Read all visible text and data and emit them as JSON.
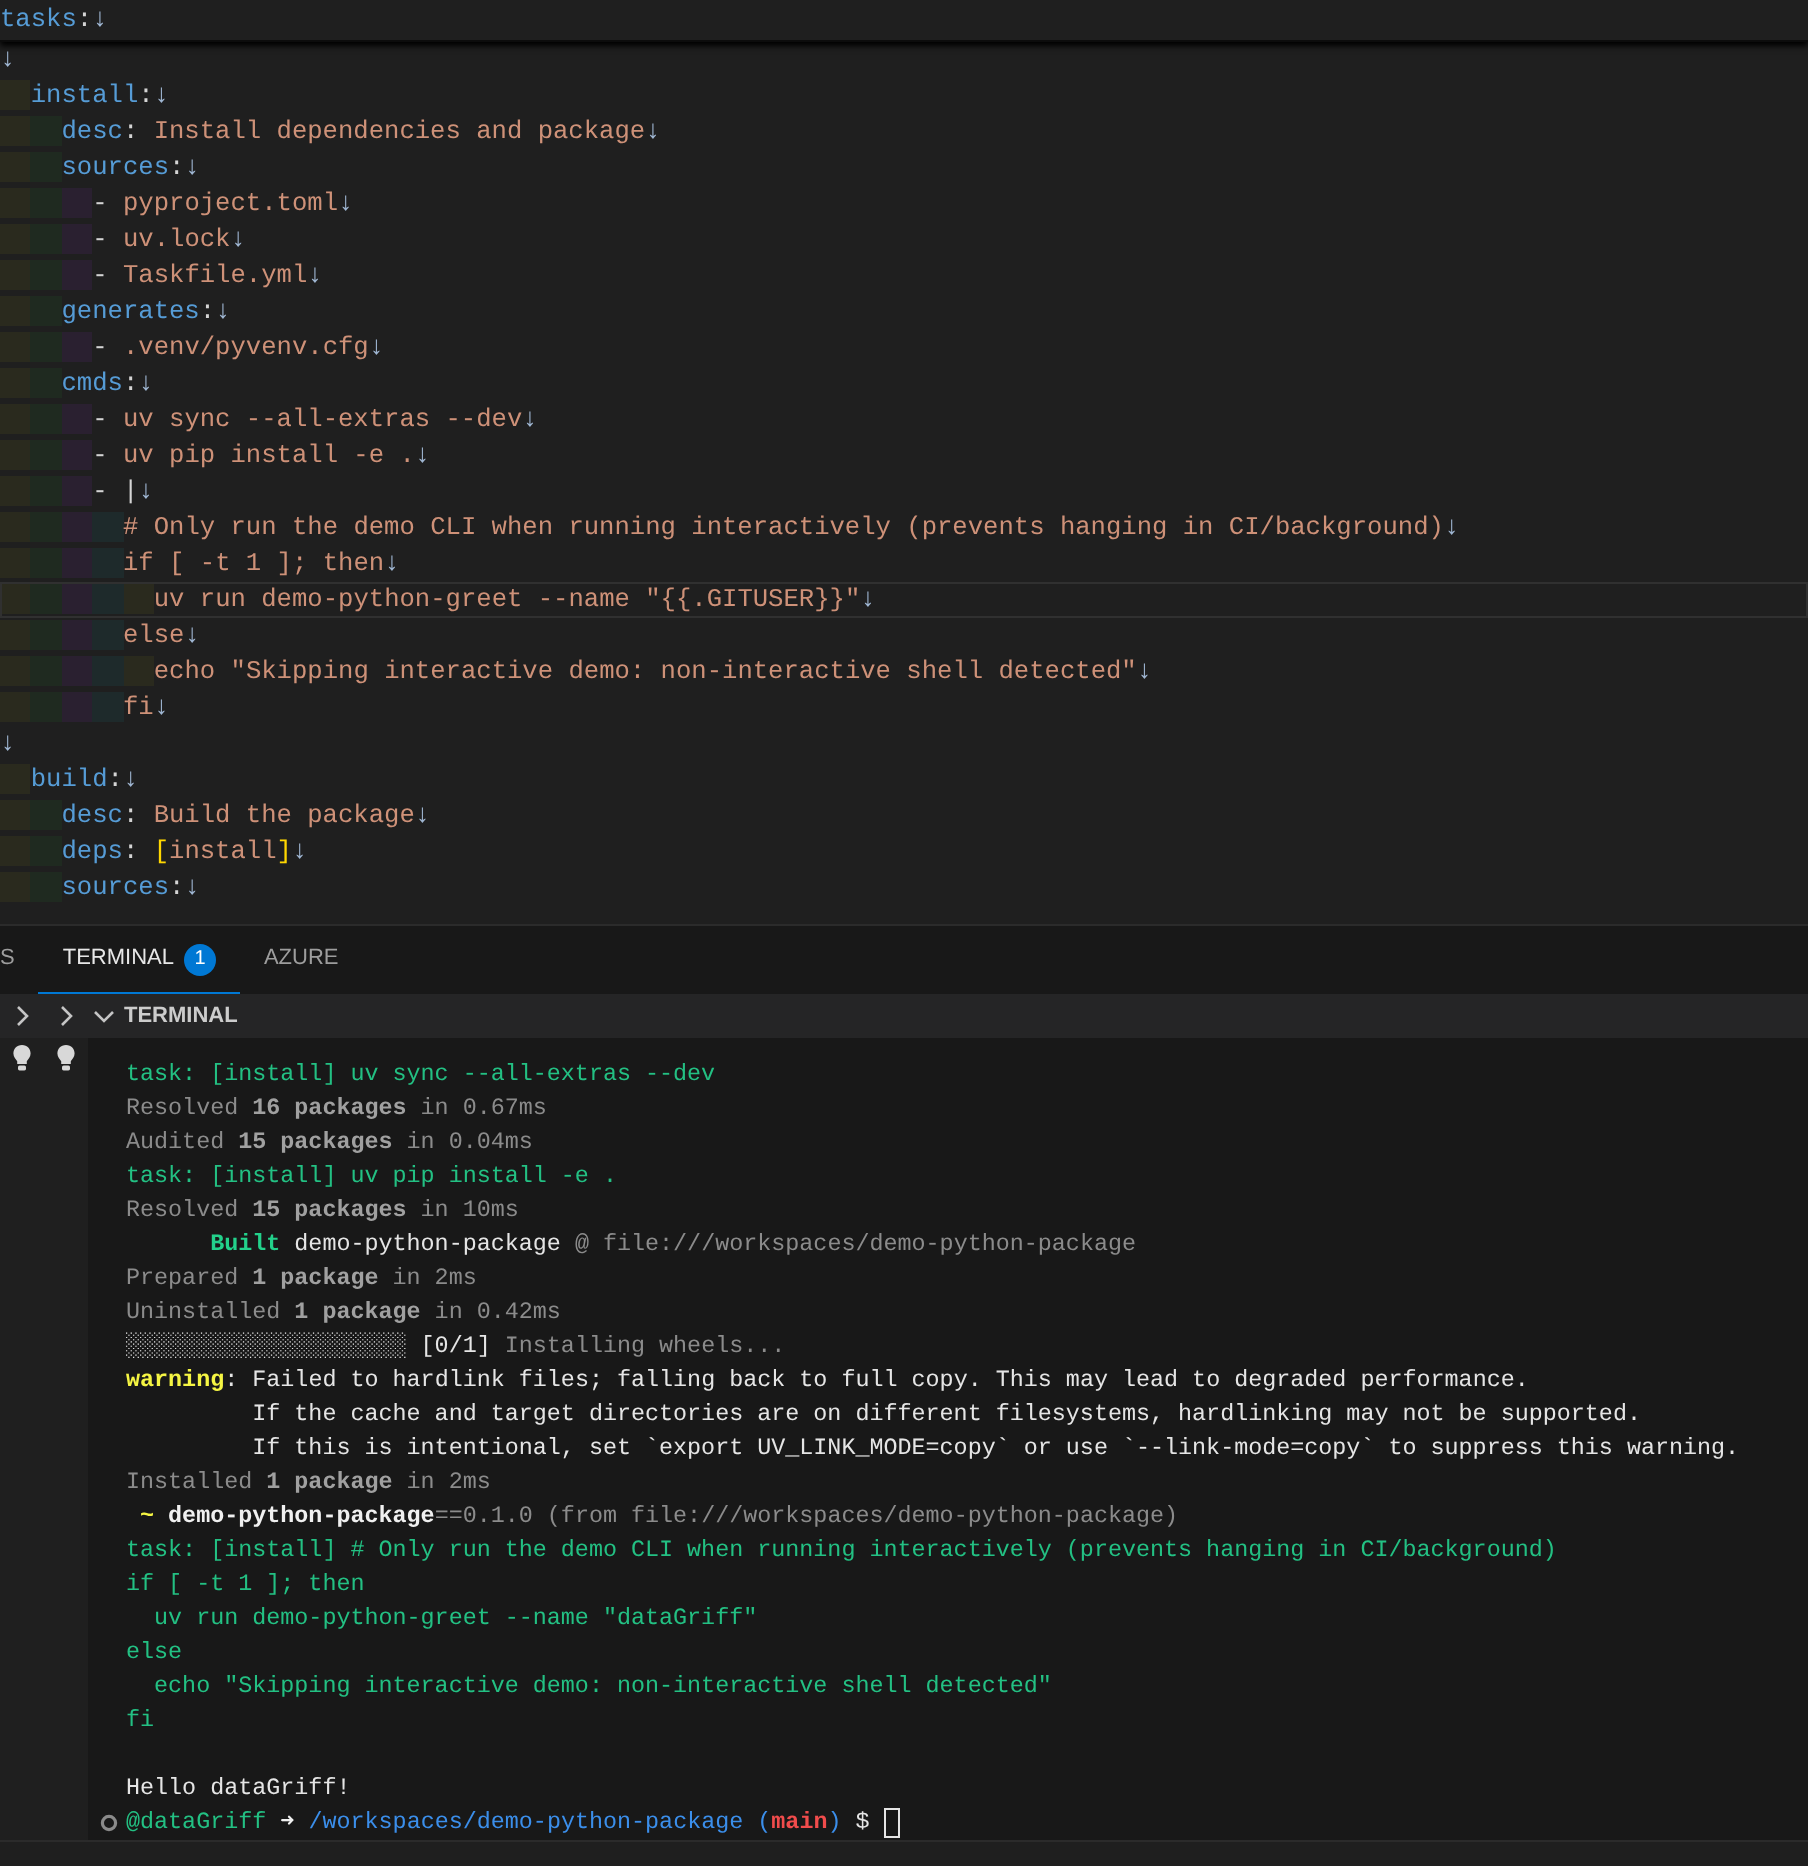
{
  "editor": {
    "sticky_line": [
      {
        "kind": "key",
        "text": "tasks"
      },
      {
        "kind": "punct",
        "text": ":"
      },
      {
        "kind": "eol",
        "text": "↓"
      }
    ],
    "lines": [
      {
        "current": false,
        "tokens": [
          {
            "kind": "eol",
            "text": "↓"
          }
        ]
      },
      {
        "current": false,
        "tokens": [
          {
            "kind": "key",
            "text": "  install"
          },
          {
            "kind": "punct",
            "text": ":"
          },
          {
            "kind": "eol",
            "text": "↓"
          }
        ]
      },
      {
        "current": false,
        "tokens": [
          {
            "kind": "key",
            "text": "    desc"
          },
          {
            "kind": "punct",
            "text": ": "
          },
          {
            "kind": "string",
            "text": "Install dependencies and package"
          },
          {
            "kind": "eol",
            "text": "↓"
          }
        ]
      },
      {
        "current": false,
        "tokens": [
          {
            "kind": "key",
            "text": "    sources"
          },
          {
            "kind": "punct",
            "text": ":"
          },
          {
            "kind": "eol",
            "text": "↓"
          }
        ]
      },
      {
        "current": false,
        "tokens": [
          {
            "kind": "punct",
            "text": "      - "
          },
          {
            "kind": "string",
            "text": "pyproject.toml"
          },
          {
            "kind": "eol",
            "text": "↓"
          }
        ]
      },
      {
        "current": false,
        "tokens": [
          {
            "kind": "punct",
            "text": "      - "
          },
          {
            "kind": "string",
            "text": "uv.lock"
          },
          {
            "kind": "eol",
            "text": "↓"
          }
        ]
      },
      {
        "current": false,
        "tokens": [
          {
            "kind": "punct",
            "text": "      - "
          },
          {
            "kind": "string",
            "text": "Taskfile.yml"
          },
          {
            "kind": "eol",
            "text": "↓"
          }
        ]
      },
      {
        "current": false,
        "tokens": [
          {
            "kind": "key",
            "text": "    generates"
          },
          {
            "kind": "punct",
            "text": ":"
          },
          {
            "kind": "eol",
            "text": "↓"
          }
        ]
      },
      {
        "current": false,
        "tokens": [
          {
            "kind": "punct",
            "text": "      - "
          },
          {
            "kind": "string",
            "text": ".venv/pyvenv.cfg"
          },
          {
            "kind": "eol",
            "text": "↓"
          }
        ]
      },
      {
        "current": false,
        "tokens": [
          {
            "kind": "key",
            "text": "    cmds"
          },
          {
            "kind": "punct",
            "text": ":"
          },
          {
            "kind": "eol",
            "text": "↓"
          }
        ]
      },
      {
        "current": false,
        "tokens": [
          {
            "kind": "punct",
            "text": "      - "
          },
          {
            "kind": "string",
            "text": "uv sync --all-extras --dev"
          },
          {
            "kind": "eol",
            "text": "↓"
          }
        ]
      },
      {
        "current": false,
        "tokens": [
          {
            "kind": "punct",
            "text": "      - "
          },
          {
            "kind": "string",
            "text": "uv pip install -e ."
          },
          {
            "kind": "eol",
            "text": "↓"
          }
        ]
      },
      {
        "current": false,
        "tokens": [
          {
            "kind": "punct",
            "text": "      - |"
          },
          {
            "kind": "eol",
            "text": "↓"
          }
        ]
      },
      {
        "current": false,
        "tokens": [
          {
            "kind": "string",
            "text": "        # Only run the demo CLI when running interactively (prevents hanging in CI/background)"
          },
          {
            "kind": "eol",
            "text": "↓"
          }
        ]
      },
      {
        "current": false,
        "tokens": [
          {
            "kind": "string",
            "text": "        if [ -t 1 ]; then"
          },
          {
            "kind": "eol",
            "text": "↓"
          }
        ]
      },
      {
        "current": true,
        "tokens": [
          {
            "kind": "string",
            "text": "          uv run demo-python-greet --name \"{{.GITUSER}}\""
          },
          {
            "kind": "eol",
            "text": "↓"
          }
        ]
      },
      {
        "current": false,
        "tokens": [
          {
            "kind": "string",
            "text": "        else"
          },
          {
            "kind": "eol",
            "text": "↓"
          }
        ]
      },
      {
        "current": false,
        "tokens": [
          {
            "kind": "string",
            "text": "          echo \"Skipping interactive demo: non-interactive shell detected\""
          },
          {
            "kind": "eol",
            "text": "↓"
          }
        ]
      },
      {
        "current": false,
        "tokens": [
          {
            "kind": "string",
            "text": "        fi"
          },
          {
            "kind": "eol",
            "text": "↓"
          }
        ]
      },
      {
        "current": false,
        "tokens": [
          {
            "kind": "eol",
            "text": "↓"
          }
        ]
      },
      {
        "current": false,
        "tokens": [
          {
            "kind": "key",
            "text": "  build"
          },
          {
            "kind": "punct",
            "text": ":"
          },
          {
            "kind": "eol",
            "text": "↓"
          }
        ]
      },
      {
        "current": false,
        "tokens": [
          {
            "kind": "key",
            "text": "    desc"
          },
          {
            "kind": "punct",
            "text": ": "
          },
          {
            "kind": "string",
            "text": "Build the package"
          },
          {
            "kind": "eol",
            "text": "↓"
          }
        ]
      },
      {
        "current": false,
        "tokens": [
          {
            "kind": "key",
            "text": "    deps"
          },
          {
            "kind": "punct",
            "text": ": "
          },
          {
            "kind": "bracket",
            "text": "["
          },
          {
            "kind": "string",
            "text": "install"
          },
          {
            "kind": "bracket",
            "text": "]"
          },
          {
            "kind": "eol",
            "text": "↓"
          }
        ]
      },
      {
        "current": false,
        "tokens": [
          {
            "kind": "key",
            "text": "    sources"
          },
          {
            "kind": "punct",
            "text": ":"
          },
          {
            "kind": "eol",
            "text": "↓"
          }
        ]
      }
    ]
  },
  "panel": {
    "tabs": [
      {
        "label": "S",
        "selected": false
      },
      {
        "label": "TERMINAL",
        "selected": true,
        "badge": "1"
      },
      {
        "label": "AZURE",
        "selected": false
      }
    ],
    "section_title": "TERMINAL",
    "terminal_lines": [
      {
        "kind": "output",
        "tokens": [
          {
            "kind": "green",
            "text": "task: [install] uv sync --all-extras --dev"
          }
        ]
      },
      {
        "kind": "output",
        "tokens": [
          {
            "kind": "dim",
            "text": "Resolved "
          },
          {
            "kind": "dimbold",
            "text": "16 packages"
          },
          {
            "kind": "dim",
            "text": " in 0.67ms"
          }
        ]
      },
      {
        "kind": "output",
        "tokens": [
          {
            "kind": "dim",
            "text": "Audited "
          },
          {
            "kind": "dimbold",
            "text": "15 packages"
          },
          {
            "kind": "dim",
            "text": " in 0.04ms"
          }
        ]
      },
      {
        "kind": "output",
        "tokens": [
          {
            "kind": "green",
            "text": "task: [install] uv pip install -e ."
          }
        ]
      },
      {
        "kind": "output",
        "tokens": [
          {
            "kind": "dim",
            "text": "Resolved "
          },
          {
            "kind": "dimbold",
            "text": "15 packages"
          },
          {
            "kind": "dim",
            "text": " in 10ms"
          }
        ]
      },
      {
        "kind": "output",
        "tokens": [
          {
            "kind": "greenbold",
            "text": "      Built"
          },
          {
            "kind": "plain",
            "text": " demo-python-package"
          },
          {
            "kind": "dim",
            "text": " @ file:///workspaces/demo-python-package"
          }
        ]
      },
      {
        "kind": "output",
        "tokens": [
          {
            "kind": "dim",
            "text": "Prepared "
          },
          {
            "kind": "dimbold",
            "text": "1 package"
          },
          {
            "kind": "dim",
            "text": " in 2ms"
          }
        ]
      },
      {
        "kind": "output",
        "tokens": [
          {
            "kind": "dim",
            "text": "Uninstalled "
          },
          {
            "kind": "dimbold",
            "text": "1 package"
          },
          {
            "kind": "dim",
            "text": " in 0.42ms"
          }
        ]
      },
      {
        "kind": "output",
        "tokens": [
          {
            "kind": "plain",
            "text": "░░░░░░░░░░░░░░░░░░░░ [0/1]"
          },
          {
            "kind": "dim",
            "text": " Installing wheels..."
          }
        ]
      },
      {
        "kind": "output",
        "tokens": [
          {
            "kind": "yellowbold",
            "text": "warning"
          },
          {
            "kind": "plain",
            "text": ": Failed to hardlink files; falling back to full copy. This may lead to degraded performance."
          }
        ]
      },
      {
        "kind": "output",
        "tokens": [
          {
            "kind": "plain",
            "text": "         If the cache and target directories are on different filesystems, hardlinking may not be supported."
          }
        ]
      },
      {
        "kind": "output",
        "tokens": [
          {
            "kind": "plain",
            "text": "         If this is intentional, set `export UV_LINK_MODE=copy` or use `--link-mode=copy` to suppress this warning."
          }
        ]
      },
      {
        "kind": "output",
        "tokens": [
          {
            "kind": "dim",
            "text": "Installed "
          },
          {
            "kind": "dimbold",
            "text": "1 package"
          },
          {
            "kind": "dim",
            "text": " in 2ms"
          }
        ]
      },
      {
        "kind": "output",
        "tokens": [
          {
            "kind": "yellowbold",
            "text": " ~"
          },
          {
            "kind": "whitebold",
            "text": " demo-python-package"
          },
          {
            "kind": "dim",
            "text": "==0.1.0 (from file:///workspaces/demo-python-package)"
          }
        ]
      },
      {
        "kind": "output",
        "tokens": [
          {
            "kind": "green",
            "text": "task: [install] # Only run the demo CLI when running interactively (prevents hanging in CI/background)"
          }
        ]
      },
      {
        "kind": "output",
        "tokens": [
          {
            "kind": "green",
            "text": "if [ -t 1 ]; then"
          }
        ]
      },
      {
        "kind": "output",
        "tokens": [
          {
            "kind": "green",
            "text": "  uv run demo-python-greet --name \"dataGriff\""
          }
        ]
      },
      {
        "kind": "output",
        "tokens": [
          {
            "kind": "green",
            "text": "else"
          }
        ]
      },
      {
        "kind": "output",
        "tokens": [
          {
            "kind": "green",
            "text": "  echo \"Skipping interactive demo: non-interactive shell detected\""
          }
        ]
      },
      {
        "kind": "output",
        "tokens": [
          {
            "kind": "green",
            "text": "fi"
          }
        ]
      },
      {
        "kind": "blank"
      },
      {
        "kind": "output",
        "tokens": [
          {
            "kind": "plain",
            "text": "Hello dataGriff!"
          }
        ]
      },
      {
        "kind": "prompt",
        "tokens": [
          {
            "kind": "green",
            "text": "@dataGriff "
          },
          {
            "kind": "whitebold",
            "text": "➜ "
          },
          {
            "kind": "blue",
            "text": "/workspaces/demo-python-package ("
          },
          {
            "kind": "red",
            "text": "main"
          },
          {
            "kind": "blue",
            "text": ")"
          },
          {
            "kind": "plain",
            "text": " $ "
          }
        ]
      }
    ]
  }
}
